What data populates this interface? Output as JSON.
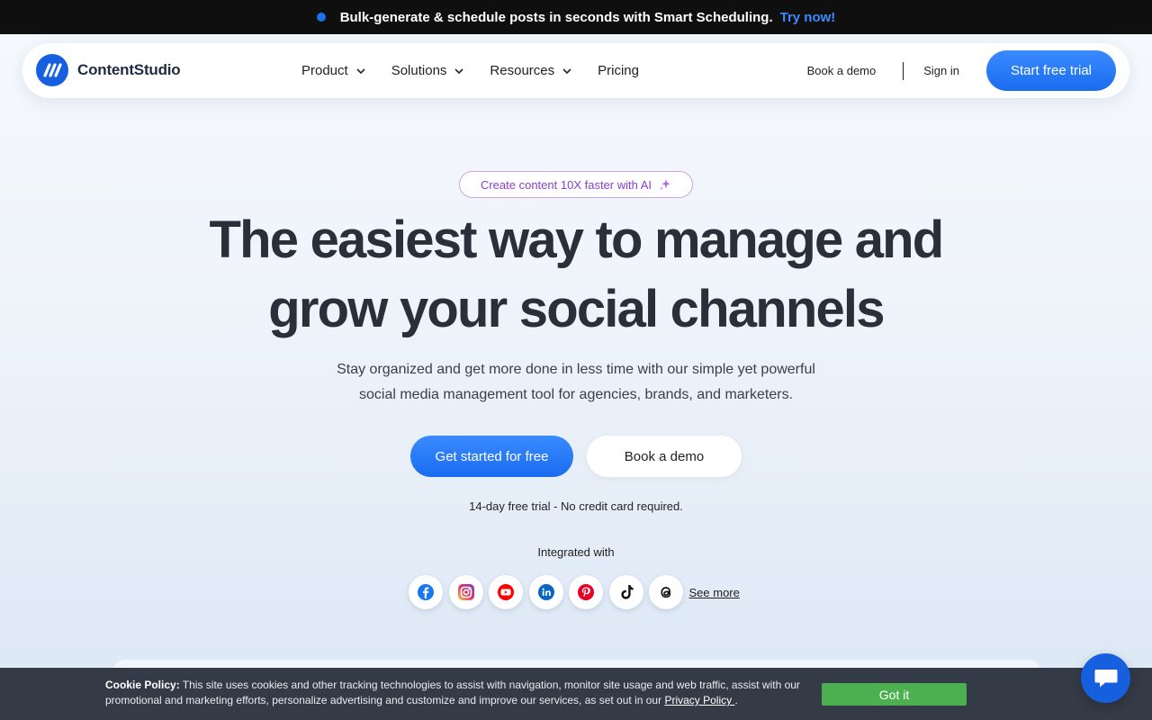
{
  "announcement": {
    "text": "Bulk-generate & schedule posts in seconds with Smart Scheduling.",
    "cta": "Try now!"
  },
  "nav": {
    "brand": "ContentStudio",
    "menu": [
      {
        "label": "Product",
        "has_dropdown": true
      },
      {
        "label": "Solutions",
        "has_dropdown": true
      },
      {
        "label": "Resources",
        "has_dropdown": true
      },
      {
        "label": "Pricing",
        "has_dropdown": false
      }
    ],
    "book_demo": "Book a demo",
    "sign_in": "Sign in",
    "start_trial": "Start free trial"
  },
  "hero": {
    "pill": "Create content 10X faster with AI",
    "title_line1": "The easiest way to manage and",
    "title_line2": "grow your social channels",
    "subtitle_line1": "Stay organized and get more done in less time with our simple yet powerful",
    "subtitle_line2": "social media management tool for agencies, brands, and marketers.",
    "primary_cta": "Get started for free",
    "secondary_cta": "Book a demo",
    "trial_note": "14-day free trial - No credit card required.",
    "integrated_label": "Integrated with",
    "integrations": [
      "facebook",
      "instagram",
      "youtube",
      "linkedin",
      "pinterest",
      "tiktok",
      "threads"
    ],
    "see_more": "See more"
  },
  "cookie": {
    "heading": "Cookie Policy:",
    "body": " This site uses cookies and other tracking technologies to assist with navigation, monitor site usage and web traffic, assist with our promotional and marketing efforts, personalize advertising and customize and improve our services, as set out in our ",
    "policy_link": "Privacy Policy ",
    "end": ".",
    "accept": "Got it"
  },
  "colors": {
    "accent": "#1a6cf0",
    "announce_bg": "#0f0f10",
    "cookie_bg": "#343a46",
    "accept_green": "#4caf50"
  }
}
